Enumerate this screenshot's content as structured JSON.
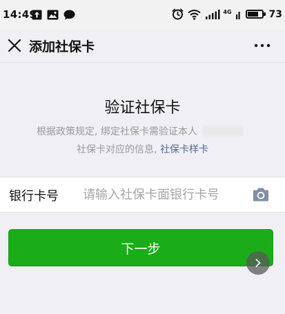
{
  "status_bar": {
    "time": "14:49",
    "network_label": "4G",
    "battery_level": "73"
  },
  "nav": {
    "title": "添加社保卡"
  },
  "main": {
    "heading": "验证社保卡",
    "description_part1": "根据政策规定, 绑定社保卡需验证本人",
    "description_part2": "社保卡对应的信息,",
    "sample_link": "社保卡样卡",
    "card_number_label": "银行卡号",
    "card_number_placeholder": "请输入社保卡面银行卡号",
    "card_number_value": "",
    "next_button": "下一步"
  },
  "colors": {
    "primary_green": "#1aad19",
    "link_blue": "#576b95",
    "background": "#efeff4"
  },
  "icons": [
    "upload-icon",
    "gallery-icon",
    "chat-icon",
    "alarm-icon",
    "wifi-icon",
    "signal-icon",
    "battery-icon",
    "close-icon",
    "more-icon",
    "camera-icon",
    "chevron-right-icon"
  ]
}
